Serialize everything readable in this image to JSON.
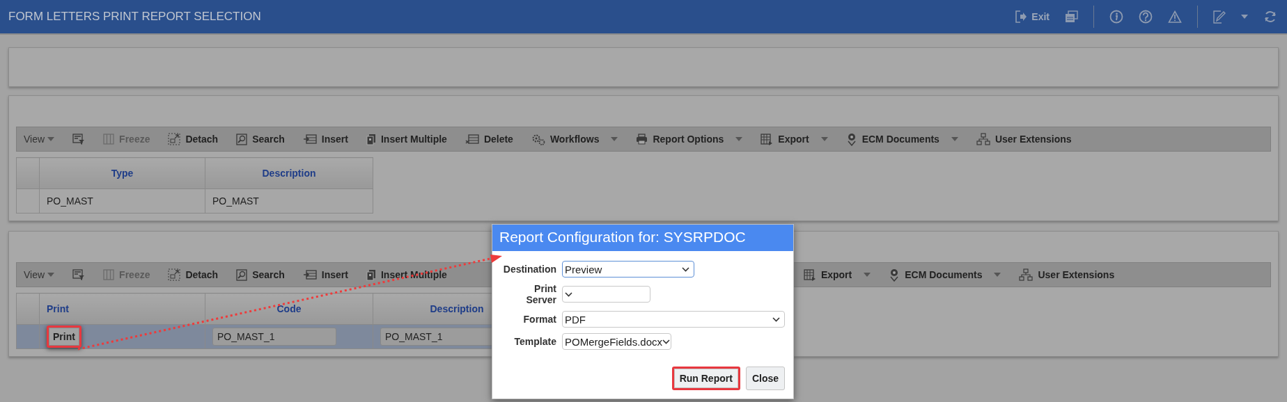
{
  "header": {
    "title": "FORM LETTERS PRINT REPORT SELECTION",
    "exit_label": "Exit"
  },
  "panels": [
    {
      "kind": "empty"
    },
    {
      "kind": "grid",
      "toolbar": {
        "items_left": [
          {
            "label": "View",
            "kind": "view",
            "disabled": false,
            "dropdown": true
          },
          {
            "kind": "filter",
            "disabled": false,
            "dropdown": false
          },
          {
            "label": "Freeze",
            "kind": "freeze",
            "disabled": true,
            "dropdown": false
          },
          {
            "label": "Detach",
            "kind": "detach",
            "disabled": false,
            "dropdown": false
          },
          {
            "label": "Search",
            "kind": "search",
            "disabled": false,
            "dropdown": false
          },
          {
            "label": "Insert",
            "kind": "insert",
            "disabled": false,
            "dropdown": false
          },
          {
            "label": "Insert Multiple",
            "kind": "multiple",
            "disabled": false,
            "dropdown": false
          },
          {
            "label": "Delete",
            "kind": "delete",
            "disabled": false,
            "dropdown": false
          },
          {
            "label": "Workflows",
            "kind": "workflows",
            "disabled": false,
            "dropdown": true
          },
          {
            "label": "Report Options",
            "kind": "printer",
            "disabled": false,
            "dropdown": true
          },
          {
            "label": "Export",
            "kind": "export",
            "disabled": false,
            "dropdown": true
          },
          {
            "label": "ECM Documents",
            "kind": "ecm",
            "disabled": false,
            "dropdown": true
          },
          {
            "label": "User Extensions",
            "kind": "extensions",
            "disabled": false,
            "dropdown": false
          }
        ]
      },
      "columns": [
        {
          "label": "Type"
        },
        {
          "label": "Description"
        }
      ],
      "rows": [
        {
          "selected": false,
          "cells": [
            {
              "kind": "text",
              "value": "PO_MAST"
            },
            {
              "kind": "text",
              "value": "PO_MAST"
            }
          ]
        }
      ]
    },
    {
      "kind": "grid",
      "toolbar": {
        "items_left": [
          {
            "label": "View",
            "kind": "view",
            "disabled": false,
            "dropdown": true
          },
          {
            "kind": "filter",
            "disabled": false,
            "dropdown": false
          },
          {
            "label": "Freeze",
            "kind": "freeze",
            "disabled": true,
            "dropdown": false
          },
          {
            "label": "Detach",
            "kind": "detach",
            "disabled": false,
            "dropdown": false
          },
          {
            "label": "Search",
            "kind": "search",
            "disabled": false,
            "dropdown": false
          },
          {
            "label": "Insert",
            "kind": "insert",
            "disabled": false,
            "dropdown": false
          },
          {
            "label": "Insert Multiple",
            "kind": "multiple",
            "disabled": false,
            "dropdown": false
          }
        ],
        "items_right": [
          {
            "label": "Export",
            "kind": "export",
            "disabled": false,
            "dropdown": true
          },
          {
            "label": "ECM Documents",
            "kind": "ecm",
            "disabled": false,
            "dropdown": true
          },
          {
            "label": "User Extensions",
            "kind": "extensions",
            "disabled": false,
            "dropdown": false
          }
        ]
      },
      "columns": [
        {
          "label": "Print"
        },
        {
          "label": "Code"
        },
        {
          "label": "Description"
        }
      ],
      "rows": [
        {
          "selected": true,
          "cells": [
            {
              "kind": "button",
              "label": "Print",
              "highlighted": true
            },
            {
              "kind": "input",
              "value": "PO_MAST_1"
            },
            {
              "kind": "input",
              "value": "PO_MAST_1"
            }
          ]
        }
      ]
    }
  ],
  "dialog": {
    "title": "Report Configuration for: SYSRPDOC",
    "fields": [
      {
        "label": "Destination",
        "value": "Preview",
        "focused": true
      },
      {
        "label": "Print Server",
        "focused": false
      },
      {
        "label": "Format",
        "value": "PDF",
        "focused": false
      },
      {
        "label": "Template",
        "value": "POMergeFields.docx",
        "focused": false
      }
    ],
    "buttons": [
      {
        "label": "Run Report",
        "highlighted": true
      },
      {
        "label": "Close",
        "highlighted": false
      }
    ]
  }
}
